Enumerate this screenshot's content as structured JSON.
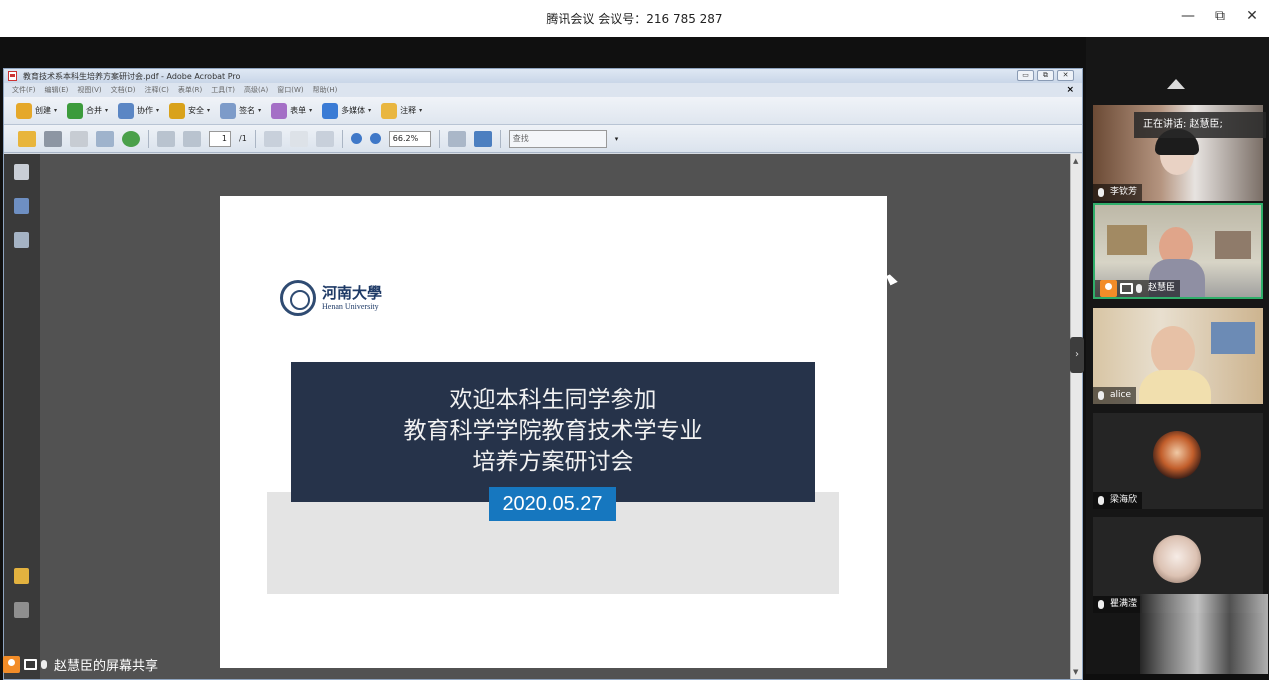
{
  "window": {
    "title": "腾讯会议 会议号：216 785 287",
    "minimize": "—",
    "restore": "⧉",
    "close": "✕"
  },
  "acrobat": {
    "title": "教育技术系本科生培养方案研讨会.pdf - Adobe Acrobat Pro",
    "menu": [
      "文件(F)",
      "编辑(E)",
      "视图(V)",
      "文档(D)",
      "注释(C)",
      "表单(R)",
      "工具(T)",
      "高级(A)",
      "窗口(W)",
      "帮助(H)"
    ],
    "toolbar": {
      "create": "创建",
      "combine": "合并",
      "collaborate": "协作",
      "secure": "安全",
      "sign": "签名",
      "forms": "表单",
      "multimedia": "多媒体",
      "comment": "注释"
    },
    "nav": {
      "page_current": "1",
      "page_total": "/1",
      "zoom": "66.2%",
      "find_placeholder": "查找"
    }
  },
  "slide": {
    "university_cn": "河南大學",
    "university_en": "Henan University",
    "line1": "欢迎本科生同学参加",
    "line2": "教育科学学院教育技术学专业",
    "line3": "培养方案研讨会",
    "date": "2020.05.27"
  },
  "participants": {
    "speaking_label": "正在讲话: 赵慧臣;",
    "list": [
      {
        "name": "李钦芳"
      },
      {
        "name": "赵慧臣"
      },
      {
        "name": "alice"
      },
      {
        "name": "梁海欣"
      },
      {
        "name": "瞿满滢"
      }
    ]
  },
  "share_label": "赵慧臣的屏幕共享",
  "colors": {
    "banner": "#26334a",
    "date_box": "#1677bf",
    "active_tile_border": "#2fae6a",
    "host_badge": "#f28c28"
  }
}
